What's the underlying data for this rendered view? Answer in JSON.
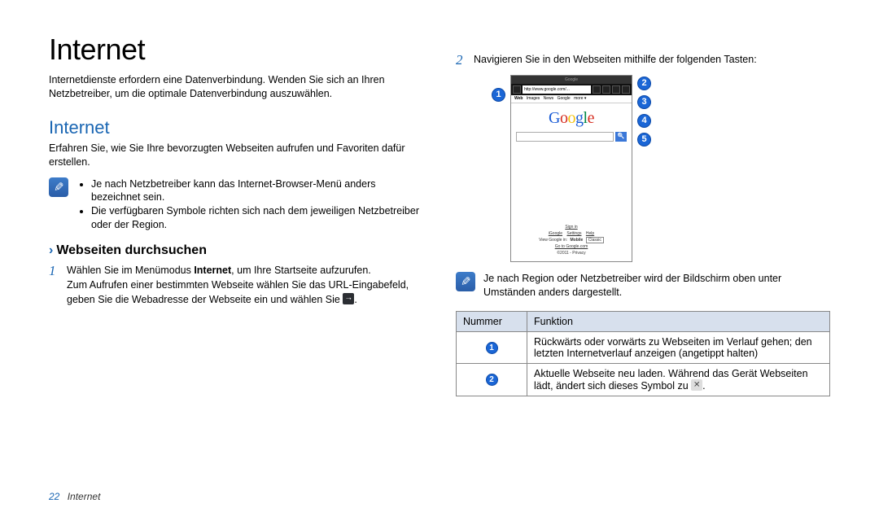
{
  "left": {
    "title": "Internet",
    "intro": "Internetdienste erfordern eine Datenverbindung. Wenden Sie sich an Ihren Netzbetreiber, um die optimale Datenverbindung auszuwählen.",
    "section_title": "Internet",
    "section_intro": "Erfahren Sie, wie Sie Ihre bevorzugten Webseiten aufrufen und Favoriten dafür erstellen.",
    "note_bullets": [
      "Je nach Netzbetreiber kann das Internet-Browser-Menü anders bezeichnet sein.",
      "Die verfügbaren Symbole richten sich nach dem jeweiligen Netzbetreiber oder der Region."
    ],
    "sub_title": "Webseiten durchsuchen",
    "step1_num": "1",
    "step1_a": "Wählen Sie im Menümodus ",
    "step1_bold": "Internet",
    "step1_b": ", um Ihre Startseite aufzurufen.",
    "step1_c": "Zum Aufrufen einer bestimmten Webseite wählen Sie das URL-Eingabefeld, geben Sie die Webadresse der Webseite ein und wählen Sie ",
    "step1_d": "."
  },
  "right": {
    "step2_num": "2",
    "step2_text": "Navigieren Sie in den Webseiten mithilfe der folgenden Tasten:",
    "screenshot": {
      "topbar": "Google",
      "url": "http://www.google.com/...",
      "tabs": {
        "web": "Web",
        "images": "Images",
        "news": "News",
        "google": "Google",
        "more": "more"
      },
      "footer": {
        "signin": "Sign in",
        "row2": [
          "iGoogle",
          "Settings",
          "Help"
        ],
        "row3_a": "View Google in: ",
        "row3_b": "Mobile",
        "row3_c": "Classic",
        "row4": "Go to Google.com",
        "row5": "©2011 - Privacy"
      }
    },
    "callouts_right": [
      "2",
      "3",
      "4",
      "5"
    ],
    "callouts_left": [
      "1"
    ],
    "note_text": "Je nach Region oder Netzbetreiber wird der Bildschirm oben unter Umständen anders dargestellt.",
    "table": {
      "head_num": "Nummer",
      "head_func": "Funktion",
      "row1_num": "1",
      "row1_func": "Rückwärts oder vorwärts zu Webseiten im Verlauf gehen; den letzten Internetverlauf anzeigen (angetippt halten)",
      "row2_num": "2",
      "row2_func_a": "Aktuelle Webseite neu laden. Während das Gerät Webseiten lädt, ändert sich dieses Symbol zu ",
      "row2_func_b": "."
    }
  },
  "footer": {
    "page_num": "22",
    "section": "Internet"
  }
}
